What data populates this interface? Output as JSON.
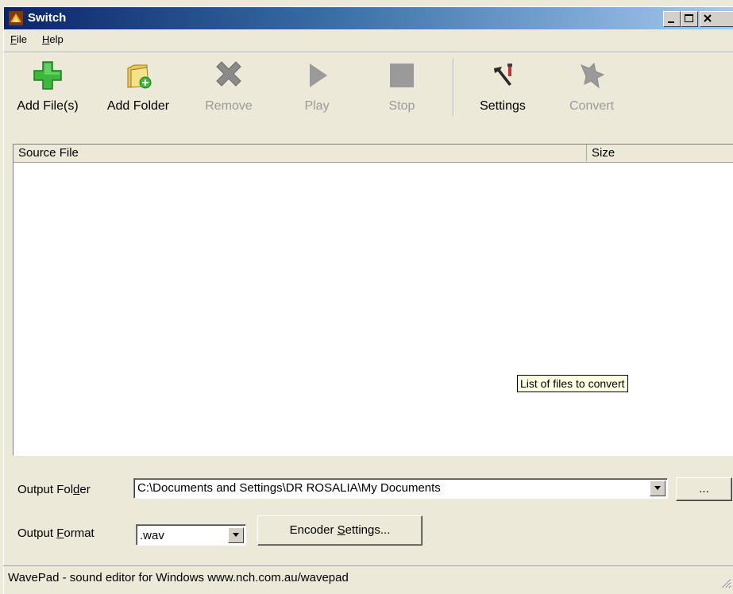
{
  "window": {
    "title": "Switch",
    "icon": "switch-app-icon"
  },
  "titlebar": {
    "minimize_icon": "minimize-icon",
    "maximize_icon": "maximize-icon",
    "close_icon": "close-icon"
  },
  "menu": [
    {
      "label": "File",
      "accel": "F",
      "rest": "ile"
    },
    {
      "label": "Help",
      "accel": "H",
      "rest": "elp"
    }
  ],
  "toolbar": {
    "add_files": {
      "label": "Add File(s)",
      "icon": "add-plus-icon"
    },
    "add_folder": {
      "label": "Add Folder",
      "icon": "add-folder-icon"
    },
    "remove": {
      "label": "Remove",
      "icon": "remove-x-icon",
      "disabled": true
    },
    "play": {
      "label": "Play",
      "icon": "play-icon",
      "disabled": true
    },
    "stop": {
      "label": "Stop",
      "icon": "stop-icon",
      "disabled": true
    },
    "settings": {
      "label": "Settings",
      "icon": "tools-icon"
    },
    "convert": {
      "label": "Convert",
      "icon": "convert-icon",
      "disabled": true
    }
  },
  "file_list": {
    "columns": [
      "Source File",
      "Size"
    ],
    "rows": [],
    "tooltip": "List of files to convert"
  },
  "output_folder": {
    "label_pre": "Output Fol",
    "label_accel": "d",
    "label_post": "er",
    "value": "C:\\Documents and Settings\\DR ROSALIA\\My Documents",
    "browse_label": "..."
  },
  "output_format": {
    "label_pre": "Output ",
    "label_accel": "F",
    "label_post": "ormat",
    "value": ".wav",
    "encoder_pre": "Encoder ",
    "encoder_accel": "S",
    "encoder_post": "ettings..."
  },
  "status": {
    "text": "WavePad - sound editor for Windows www.nch.com.au/wavepad"
  },
  "colors": {
    "titlebar_start": "#0a246a",
    "face": "#ece9d8",
    "tooltip_bg": "#ffffe1",
    "add_green": "#3cb93c"
  }
}
